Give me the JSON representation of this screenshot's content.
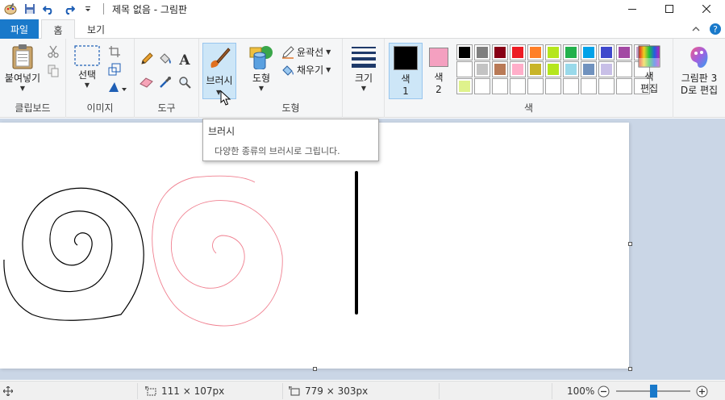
{
  "app": {
    "title": "제목 없음 - 그림판"
  },
  "tabs": {
    "file": "파일",
    "home": "홈",
    "view": "보기"
  },
  "ribbon": {
    "clipboard": {
      "paste": "붙여넣기",
      "label": "클립보드"
    },
    "image": {
      "select": "선택",
      "label": "이미지"
    },
    "tools": {
      "label": "도구"
    },
    "brushes": {
      "label": "브러시"
    },
    "shapes": {
      "shapes": "도형",
      "outline": "윤곽선",
      "fill": "채우기",
      "label": "도형"
    },
    "size": {
      "label": "크기"
    },
    "colors": {
      "color1": "색\n1",
      "color2": "색\n2",
      "edit": "색\n편집",
      "label": "색",
      "color1_value": "#000000",
      "color2_value": "#f4a0c0",
      "palette": [
        "#000000",
        "#7f7f7f",
        "#880015",
        "#ed1c24",
        "#ff7f27",
        "#b5e61d",
        "#22b14c",
        "#00a2e8",
        "#3f48cc",
        "#a349a4",
        "#c8a0c8",
        "#ffffff",
        "#c3c3c3",
        "#b97a57",
        "#ffaec9",
        "#c8b428",
        "#b5e61d",
        "#99d9ea",
        "#7092be",
        "#c8bfe7",
        "#ffffff",
        "#ffffff",
        "#dff28c",
        "#ffffff",
        "#ffffff",
        "#ffffff",
        "#ffffff",
        "#ffffff",
        "#ffffff",
        "#ffffff",
        "#ffffff",
        "#ffffff",
        "#ffffff"
      ]
    },
    "paint3d": {
      "label": "그림판 3\nD로 편집"
    }
  },
  "tooltip": {
    "title": "브러시",
    "description": "다양한 종류의 브러시로 그립니다."
  },
  "statusbar": {
    "selection_size": "111 × 107px",
    "canvas_size": "779 × 303px",
    "zoom": "100%",
    "zoom_level": 0.5
  }
}
